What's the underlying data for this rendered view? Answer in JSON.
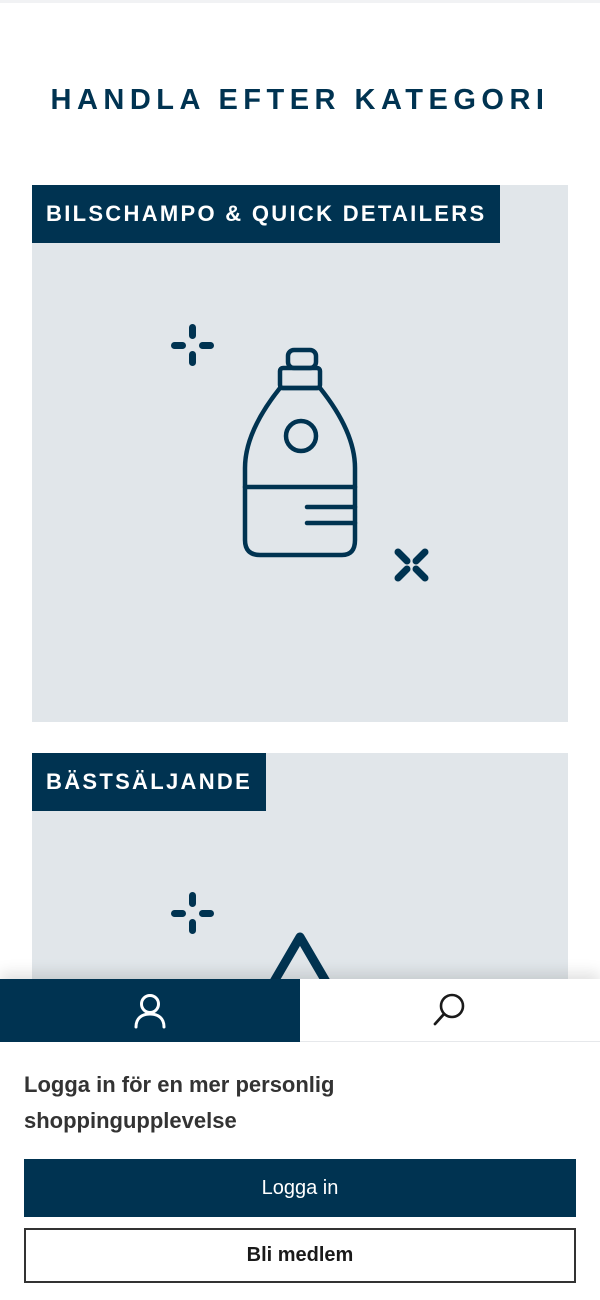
{
  "shop_by_category": {
    "title": "HANDLA EFTER KATEGORI",
    "categories": [
      {
        "label": "BILSCHAMPO & QUICK DETAILERS",
        "icon": "shampoo-bottle-icon"
      },
      {
        "label": "BÄSTSÄLJANDE",
        "icon": "bestseller-icon"
      }
    ]
  },
  "tab_bar": {
    "tabs": [
      {
        "icon": "user-icon",
        "active": true
      },
      {
        "icon": "search-icon",
        "active": false
      }
    ]
  },
  "login_panel": {
    "prompt": "Logga in för en mer personlig shoppingupplevelse",
    "login_label": "Logga in",
    "join_label": "Bli medlem"
  },
  "colors": {
    "brand_navy": "#003351",
    "card_background": "#e1e6ea",
    "text_dark": "#333333"
  }
}
